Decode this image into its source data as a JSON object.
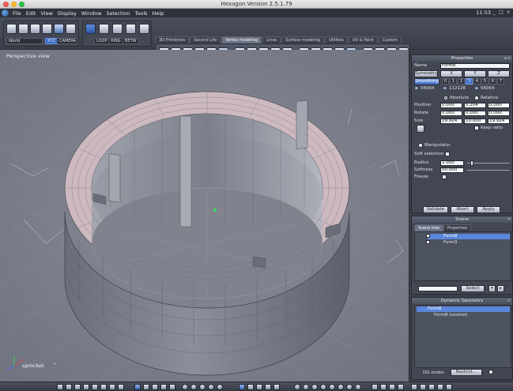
{
  "window": {
    "title": "Hexagon Version 2.5.1.79",
    "clock": "11:53"
  },
  "menu": [
    "File",
    "Edit",
    "View",
    "Display",
    "Window",
    "Selection",
    "Tools",
    "Help"
  ],
  "toolbar": {
    "coord_system": "World",
    "xyz_label": "XYZ",
    "camera_label": "CAMERA",
    "select_modes": [
      "LOOP",
      "RING",
      "BETW"
    ],
    "tabs": [
      "3D Primitives",
      "Second Life",
      "Vertex modeling",
      "Lines",
      "Surface modeling",
      "Utilities",
      "UV & Paint",
      "Custom"
    ],
    "active_tab": "Vertex modeling"
  },
  "viewport": {
    "label": "Perspective view",
    "object_name": "sprocket",
    "object_marker": "*"
  },
  "properties": {
    "title": "Properties",
    "name_label": "Name",
    "name_value": "Form8",
    "symmetry_label": "Symmetry",
    "axes": [
      "X",
      "Y",
      "Z"
    ],
    "smoothing_label": "Smoothing",
    "smoothing_levels": [
      "0",
      "1",
      "2",
      "3",
      "4",
      "5",
      "6",
      "7"
    ],
    "smoothing_selected": "3",
    "stats": [
      "56064",
      "112128",
      "56064"
    ],
    "mode_absolute": "Absolute",
    "mode_relative": "Relative",
    "position_label": "Position",
    "position": [
      "0.000",
      "5.204",
      "0.000"
    ],
    "rotate_label": "Rotate",
    "rotate": [
      "0.000",
      "0.000",
      "0.000"
    ],
    "size_label": "Size",
    "size": [
      "19.924",
      "10.000",
      "19.924"
    ],
    "keep_ratio_label": "Keep ratio",
    "manipulator_label": "Manipulator",
    "soft_selection_label": "Soft selection",
    "radius_label": "Radius",
    "radius_value": "1.000",
    "softness_label": "Softness",
    "softness_value": "50.000",
    "freeze_label": "Freeze",
    "validate_label": "Validate",
    "abort_label": "Abort",
    "apply_label": "Apply"
  },
  "scene": {
    "title": "Scene",
    "tabs": [
      "Scene tree",
      "Properties"
    ],
    "items": [
      "Form8",
      "Form3"
    ],
    "selected": "Form8",
    "select_label": "Select"
  },
  "dynamic_geometry": {
    "title": "Dynamic Geometry",
    "items": [
      "Form8",
      "Form8 (control)"
    ],
    "dg_mode_label": "DG mode:",
    "dg_mode_value": "Restrict..."
  }
}
